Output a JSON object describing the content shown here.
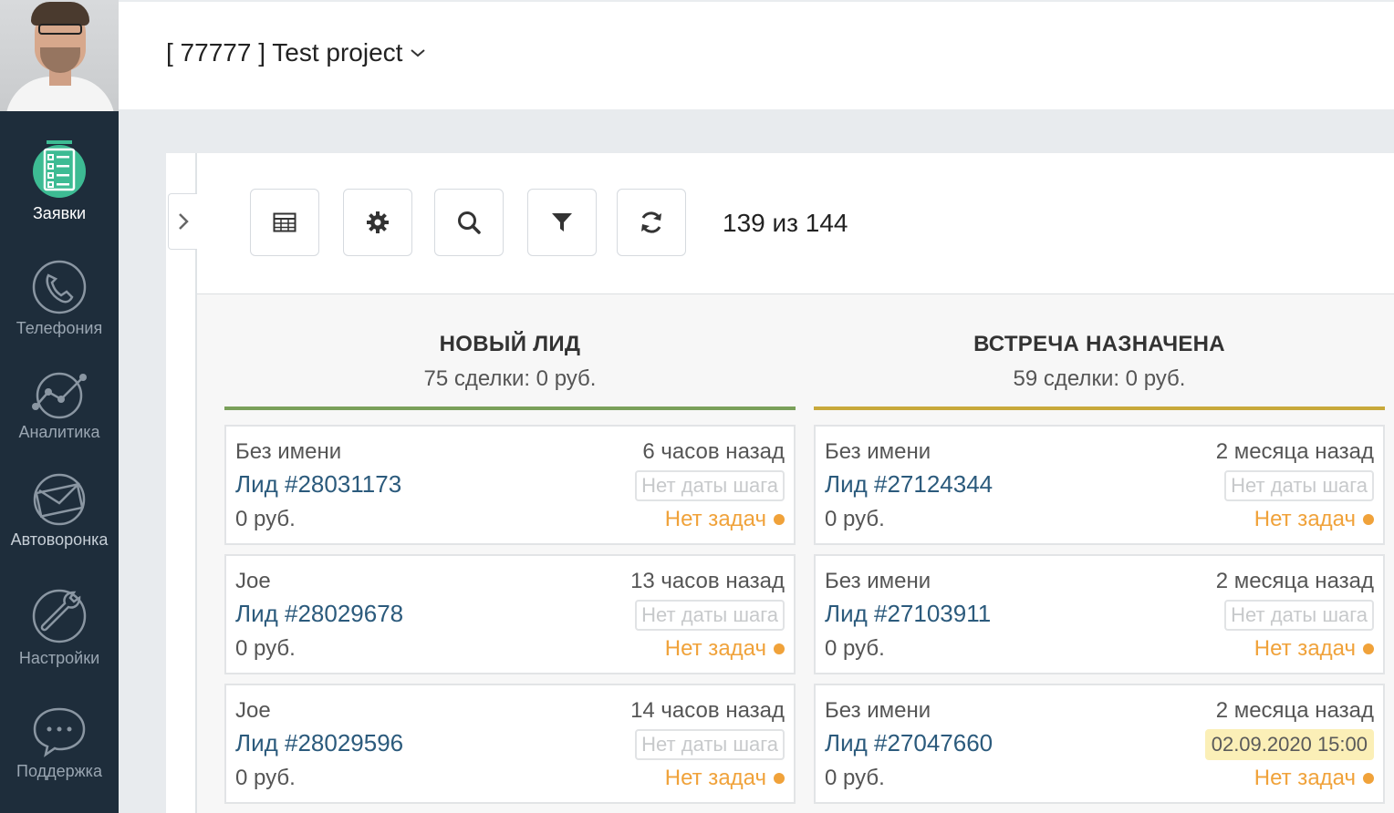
{
  "project": {
    "title": "[ 77777 ] Test project"
  },
  "sidebar": {
    "items": [
      {
        "label": "Заявки",
        "icon": "list-icon",
        "active": true
      },
      {
        "label": "Телефония",
        "icon": "phone-icon"
      },
      {
        "label": "Аналитика",
        "icon": "analytics-icon"
      },
      {
        "label": "Автоворонка",
        "icon": "mail-icon"
      },
      {
        "label": "Настройки",
        "icon": "wrench-icon"
      },
      {
        "label": "Поддержка",
        "icon": "chat-icon"
      }
    ]
  },
  "toolbar": {
    "buttons": [
      "table-icon",
      "gear-icon",
      "search-icon",
      "filter-icon",
      "refresh-icon"
    ],
    "count": "139 из 144"
  },
  "colors": {
    "sidebar": "#1e2d3b",
    "accent": "#3dbb93",
    "col1_line": "#7aa05a",
    "col2_line": "#c8a93b",
    "link": "#2b5a7c",
    "tasks": "#f0a23a"
  },
  "columns": [
    {
      "title": "НОВЫЙ ЛИД",
      "summary": "75 сделки: 0 руб.",
      "cards": [
        {
          "name": "Без имени",
          "time": "6 часов назад",
          "lead": "Лид #28031173",
          "step": "Нет даты шага",
          "price": "0 руб.",
          "tasks": "Нет задач"
        },
        {
          "name": "Joe",
          "time": "13 часов назад",
          "lead": "Лид #28029678",
          "step": "Нет даты шага",
          "price": "0 руб.",
          "tasks": "Нет задач"
        },
        {
          "name": "Joe",
          "time": "14 часов назад",
          "lead": "Лид #28029596",
          "step": "Нет даты шага",
          "price": "0 руб.",
          "tasks": "Нет задач"
        }
      ]
    },
    {
      "title": "ВСТРЕЧА НАЗНАЧЕНА",
      "summary": "59 сделки: 0 руб.",
      "cards": [
        {
          "name": "Без имени",
          "time": "2 месяца назад",
          "lead": "Лид #27124344",
          "step": "Нет даты шага",
          "price": "0 руб.",
          "tasks": "Нет задач"
        },
        {
          "name": "Без имени",
          "time": "2 месяца назад",
          "lead": "Лид #27103911",
          "step": "Нет даты шага",
          "price": "0 руб.",
          "tasks": "Нет задач"
        },
        {
          "name": "Без имени",
          "time": "2 месяца назад",
          "lead": "Лид #27047660",
          "step": "02.09.2020 15:00",
          "price": "0 руб.",
          "tasks": "Нет задач"
        }
      ]
    }
  ]
}
